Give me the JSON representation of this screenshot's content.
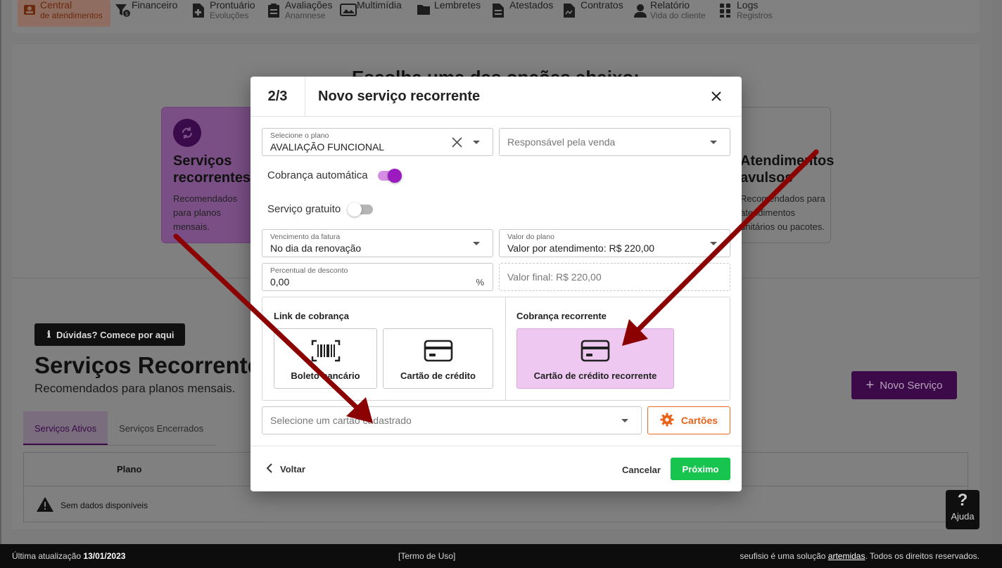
{
  "nav": {
    "items": [
      {
        "label": "Central",
        "sub": "de atendimentos",
        "icon": "person-badge-icon"
      },
      {
        "label": "Financeiro",
        "sub": "",
        "icon": "filter-money-icon"
      },
      {
        "label": "Prontuário",
        "sub": "Evoluções",
        "icon": "medical-file-icon"
      },
      {
        "label": "Avaliações",
        "sub": "Anamnese",
        "icon": "clipboard-icon"
      },
      {
        "label": "Multimídia",
        "sub": "",
        "icon": "images-icon"
      },
      {
        "label": "Lembretes",
        "sub": "",
        "icon": "folder-icon"
      },
      {
        "label": "Atestados",
        "sub": "",
        "icon": "document-icon"
      },
      {
        "label": "Contratos",
        "sub": "",
        "icon": "contract-icon"
      },
      {
        "label": "Relatório",
        "sub": "Vida do cliente",
        "icon": "user-icon"
      },
      {
        "label": "Logs",
        "sub": "Registros",
        "icon": "grid-icon"
      }
    ]
  },
  "background": {
    "choose_title": "Escolha uma das opções abaixo:",
    "card_left_title": "Serviços recorrentes",
    "card_left_desc": "Recomendados para planos mensais.",
    "card_right_title": "Atendimentos avulsos",
    "card_right_desc": "Recomendados para atendimentos unitários ou pacotes.",
    "help_pill": "Dúvidas? Comece por aqui",
    "page_title": "Serviços Recorrentes",
    "page_sub": "Recomendados para planos mensais.",
    "tab_active": "Serviços Ativos",
    "tab_closed": "Serviços Encerrados",
    "new_service": "Novo Serviço",
    "table_header_plan": "Plano",
    "empty_text": "Sem dados disponíveis"
  },
  "footer": {
    "updated_label": "Última atualização",
    "updated_date": "13/01/2023",
    "terms": "[Termo de Uso]",
    "right_prefix": "seufisio é uma solução ",
    "right_brand": "artemidas",
    "right_suffix": ". Todos os direitos reservados."
  },
  "help_float": {
    "label": "Ajuda",
    "glyph": "?"
  },
  "modal": {
    "step": "2/3",
    "title": "Novo serviço recorrente",
    "plan": {
      "label": "Selecione o plano",
      "value": "AVALIAÇÃO FUNCIONAL"
    },
    "seller": {
      "placeholder": "Responsável pela venda"
    },
    "auto_billing": {
      "label": "Cobrança automática",
      "on": true
    },
    "free_service": {
      "label": "Serviço gratuito",
      "on": false
    },
    "due": {
      "label": "Vencimento da fatura",
      "value": "No dia da renovação"
    },
    "plan_value": {
      "label": "Valor do plano",
      "value": "Valor por atendimento: R$ 220,00"
    },
    "discount": {
      "label": "Percentual de desconto",
      "value": "0,00",
      "suffix": "%"
    },
    "final_value": "Valor final: R$ 220,00",
    "link_section": "Link de cobrança",
    "recurring_section": "Cobrança recorrente",
    "opt_boleto": "Boleto bancário",
    "opt_card": "Cartão de crédito",
    "opt_recurring_card": "Cartão de crédito recorrente",
    "card_select_placeholder": "Selecione um cartão cadastrado",
    "cards_button": "Cartões",
    "back": "Voltar",
    "cancel": "Cancelar",
    "next": "Próximo"
  },
  "colors": {
    "accent_purple": "#9b1bc1",
    "selected_option_bg": "#efc8f2",
    "next_green": "#17c44e",
    "cards_orange": "#e8621a",
    "annotation_arrow": "#8b0000"
  }
}
